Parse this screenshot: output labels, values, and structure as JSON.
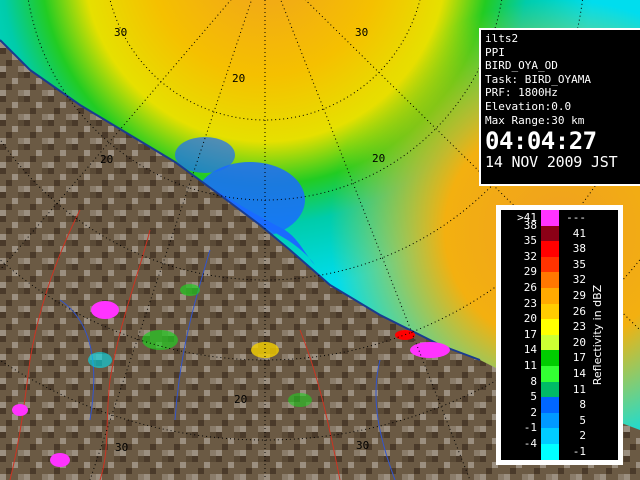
{
  "info_panel": {
    "site": "ilts2",
    "mode": "PPI",
    "product": "BIRD_OYA_OD",
    "task": "Task: BIRD_OYAMA",
    "prf": "PRF: 1800Hz",
    "elevation": "Elevation:0.0",
    "max_range": "Max Range:30 km",
    "time": "04:04:27",
    "date": "14 NOV 2009 JST"
  },
  "range_labels": [
    "20",
    "20",
    "20",
    "20",
    "30",
    "30",
    "30",
    "30"
  ],
  "legend": {
    "title": "Reflectivity in dBZ",
    "rows": [
      {
        "upper": ">41",
        "lower": "---",
        "color": "#ff33ff"
      },
      {
        "upper": "38",
        "lower": "41",
        "color": "#8b0016"
      },
      {
        "upper": "35",
        "lower": "38",
        "color": "#ff0000"
      },
      {
        "upper": "32",
        "lower": "35",
        "color": "#ff3300"
      },
      {
        "upper": "29",
        "lower": "32",
        "color": "#ff7700"
      },
      {
        "upper": "26",
        "lower": "29",
        "color": "#ffaa00"
      },
      {
        "upper": "23",
        "lower": "26",
        "color": "#ffcc00"
      },
      {
        "upper": "20",
        "lower": "23",
        "color": "#ffff00"
      },
      {
        "upper": "17",
        "lower": "20",
        "color": "#ccff33"
      },
      {
        "upper": "14",
        "lower": "17",
        "color": "#00cc00"
      },
      {
        "upper": "11",
        "lower": "14",
        "color": "#33ff33"
      },
      {
        "upper": "8",
        "lower": "11",
        "color": "#00bb66"
      },
      {
        "upper": "5",
        "lower": "8",
        "color": "#0066ff"
      },
      {
        "upper": "2",
        "lower": "5",
        "color": "#0099ff"
      },
      {
        "upper": "-1",
        "lower": "2",
        "color": "#00ccff"
      },
      {
        "upper": "-4",
        "lower": "-1",
        "color": "#00ffff"
      }
    ]
  },
  "colors": {
    "land": "#6b5a44",
    "land_dark": "#4a3a2a",
    "land_light": "#9b8f80",
    "echo_blue": "#1a6bff",
    "echo_cyan": "#00ddee",
    "echo_green": "#22cc22",
    "echo_yellow": "#f5d000",
    "echo_orange": "#f0a020",
    "coast_line": "#1a3c8f",
    "river_line": "#cc3322"
  }
}
